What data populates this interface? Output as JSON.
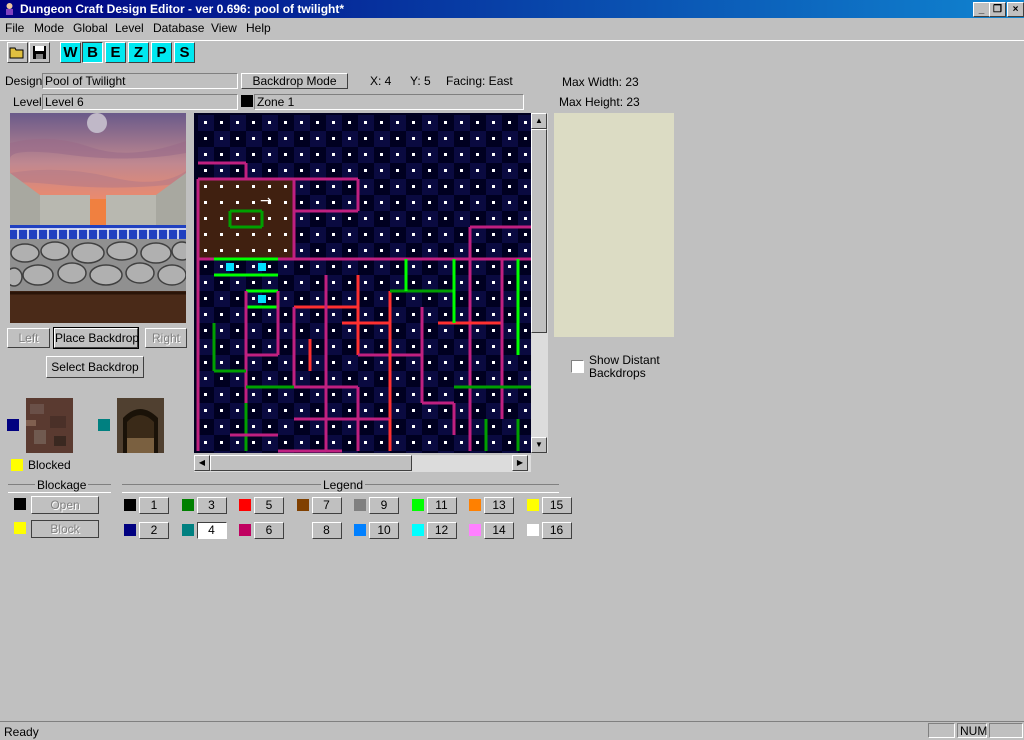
{
  "window": {
    "title": "Dungeon Craft Design Editor - ver 0.696: pool of twilight*",
    "min_label": "_",
    "restore_label": "❐",
    "close_label": "×"
  },
  "menu": [
    "File",
    "Mode",
    "Global",
    "Level",
    "Database",
    "View",
    "Help"
  ],
  "toolbar": {
    "modes": [
      "W",
      "B",
      "E",
      "Z",
      "P",
      "S"
    ],
    "active_mode": "B"
  },
  "info": {
    "design_label": "Design",
    "design_value": "Pool of Twilight",
    "level_label": "Level",
    "level_value": "Level 6",
    "mode_button": "Backdrop Mode",
    "x_label": "X: 4",
    "y_label": "Y: 5",
    "facing_label": "Facing: East",
    "zone_value": "Zone 1",
    "max_width": "Max Width: 23",
    "max_height": "Max Height: 23"
  },
  "preview": {
    "left_button": "Left",
    "place_button": "Place Backdrop",
    "right_button": "Right",
    "select_button": "Select Backdrop"
  },
  "side": {
    "show_distant_label_1": "Show Distant",
    "show_distant_label_2": "Backdrops",
    "show_distant_checked": false
  },
  "textures": {
    "blocked_label": "Blocked",
    "swatch1_color": "#000080",
    "swatch2_color": "#008080",
    "blocked_color": "#ffff00"
  },
  "blockage": {
    "title": "Blockage",
    "open_button": "Open",
    "block_button": "Block",
    "open_color": "#000000",
    "block_color": "#ffff00"
  },
  "legend": {
    "title": "Legend",
    "selected": "4",
    "items": [
      {
        "label": "1",
        "color": "#000000"
      },
      {
        "label": "2",
        "color": "#000080"
      },
      {
        "label": "3",
        "color": "#008000"
      },
      {
        "label": "4",
        "color": "#008080"
      },
      {
        "label": "5",
        "color": "#ff0000"
      },
      {
        "label": "6",
        "color": "#c00060"
      },
      {
        "label": "7",
        "color": "#804000"
      },
      {
        "label": "8",
        "color": "#c0c0c0"
      },
      {
        "label": "9",
        "color": "#808080"
      },
      {
        "label": "10",
        "color": "#0080ff"
      },
      {
        "label": "11",
        "color": "#00ff00"
      },
      {
        "label": "12",
        "color": "#00ffff"
      },
      {
        "label": "13",
        "color": "#ff8000"
      },
      {
        "label": "14",
        "color": "#ff80ff"
      },
      {
        "label": "15",
        "color": "#ffff00"
      },
      {
        "label": "16",
        "color": "#ffffff"
      }
    ]
  },
  "statusbar": {
    "text": "Ready",
    "num": "NUM"
  }
}
